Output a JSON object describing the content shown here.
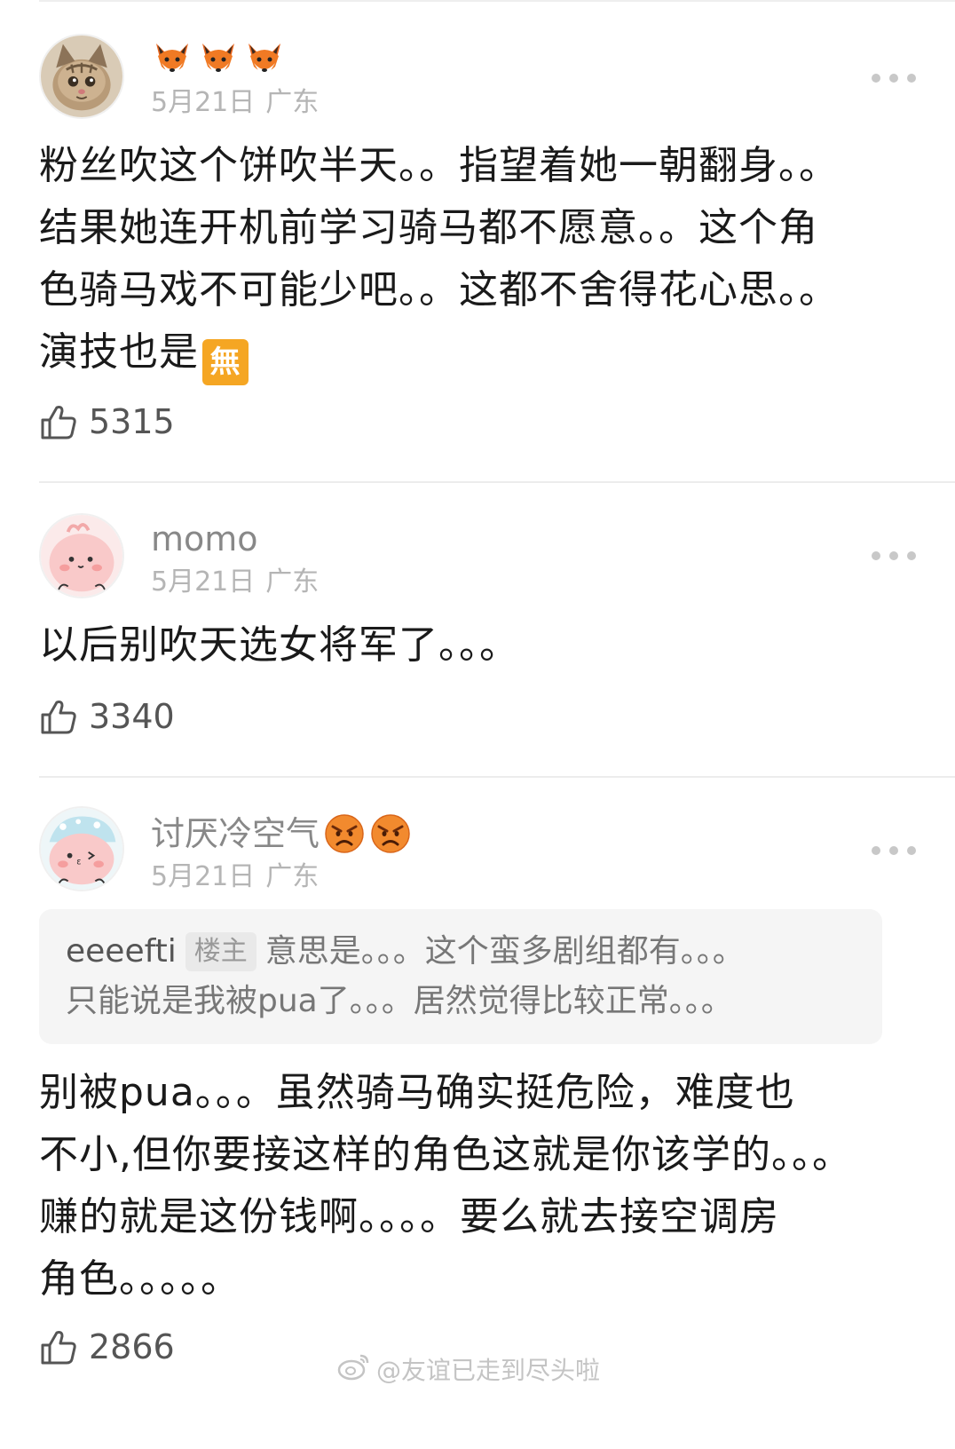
{
  "comments": [
    {
      "username": "",
      "name_emojis": [
        "fox-emoji",
        "fox-emoji",
        "fox-emoji"
      ],
      "date": "5月21日",
      "location": "广东",
      "lines": [
        "粉丝吹这个饼吹半天。。指望着她一朝翻身。。",
        "结果她连开机前学习骑马都不愿意。。这个角",
        "色骑马戏不可能少吧。。这都不舍得花心思。。",
        "演技也是"
      ],
      "inline_badge": "無",
      "likes": "5315"
    },
    {
      "username": "momo",
      "date": "5月21日",
      "location": "广东",
      "lines": [
        "以后别吹天选女将军了。。。"
      ],
      "likes": "3340"
    },
    {
      "username": "讨厌冷空气",
      "name_emojis": [
        "angry-emoji",
        "angry-emoji"
      ],
      "date": "5月21日",
      "location": "广东",
      "quote": {
        "author": "eeeefti",
        "badge": "楼主",
        "line1": "意思是。。。这个蛮多剧组都有。。。",
        "line2": "只能说是我被pua了。。。居然觉得比较正常。。。"
      },
      "lines": [
        "别被pua。。。虽然骑马确实挺危险，难度也",
        "不小,但你要接这样的角色这就是你该学的。。。",
        "赚的就是这份钱啊。。。。要么就去接空调房",
        "角色。。。。。"
      ],
      "likes": "2866"
    }
  ],
  "watermark": "@友谊已走到尽头啦",
  "icons": {
    "like": "thumbs-up-icon",
    "more": "more-icon",
    "watermark": "weibo-logo-icon"
  },
  "colors": {
    "text": "#1a1a1a",
    "meta": "#b5b5b5",
    "badge": "#f5a623"
  }
}
